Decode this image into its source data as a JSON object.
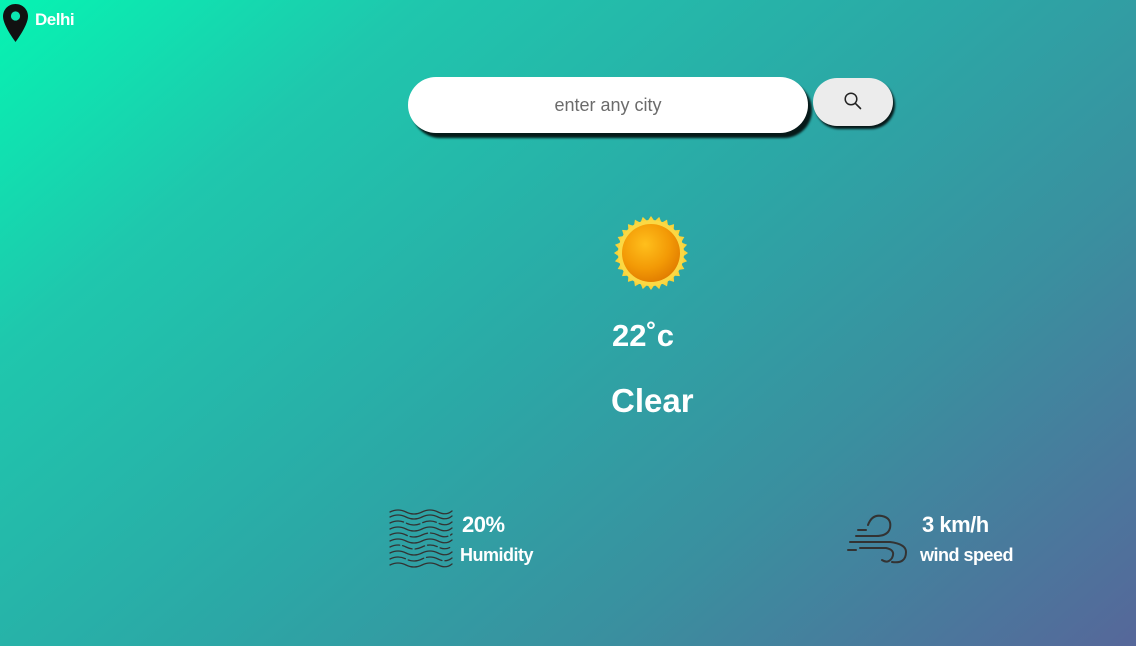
{
  "location": {
    "icon": "map-pin-icon",
    "city": "Delhi"
  },
  "search": {
    "placeholder": "enter any city",
    "value": "",
    "button_icon": "search-icon"
  },
  "weather": {
    "icon": "sun-icon",
    "temperature_value": "22",
    "temperature_unit": "˚c",
    "condition": "Clear"
  },
  "humidity": {
    "icon": "humidity-icon",
    "value": "20%",
    "label": "Humidity"
  },
  "wind": {
    "icon": "wind-icon",
    "value": "3 km/h",
    "label": "wind speed"
  },
  "colors": {
    "gradient_start": "#06f4b2",
    "gradient_end": "#56679a",
    "text": "#ffffff",
    "sun_outer": "#f8d33a",
    "sun_inner": "#e98a00"
  }
}
